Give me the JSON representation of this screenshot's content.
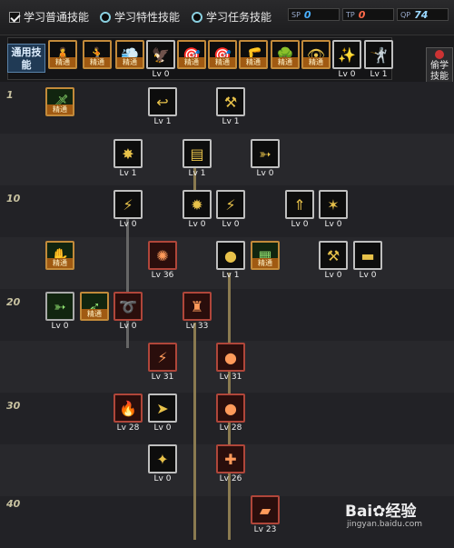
{
  "topbar": {
    "options": [
      {
        "label": "学习普通技能",
        "type": "checkbox",
        "checked": true
      },
      {
        "label": "学习特性技能",
        "type": "radio"
      },
      {
        "label": "学习任务技能",
        "type": "radio"
      }
    ],
    "sp": [
      {
        "tag": "SP",
        "value": "0",
        "color": "#4ab0ff"
      },
      {
        "tag": "TP",
        "value": "0",
        "color": "#ff6a4a"
      },
      {
        "tag": "QP",
        "value": "74",
        "color": "#9ad8ff"
      }
    ]
  },
  "common_skills": {
    "label": "通用技能",
    "items": [
      {
        "icon": "figure-icon",
        "glyph": "🧍",
        "badge": "精通"
      },
      {
        "icon": "leap-icon",
        "glyph": "🏃",
        "badge": "精通"
      },
      {
        "icon": "dash-icon",
        "glyph": "💨",
        "badge": "精通"
      },
      {
        "icon": "wing-icon",
        "glyph": "🦅",
        "level": "Lv 0"
      },
      {
        "icon": "target-icon",
        "glyph": "🎯",
        "badge": "精通"
      },
      {
        "icon": "target-icon",
        "glyph": "🎯",
        "badge": "精通"
      },
      {
        "icon": "kick-icon",
        "glyph": "🦵",
        "badge": "精通"
      },
      {
        "icon": "tree-icon",
        "glyph": "🌳",
        "badge": "精通"
      },
      {
        "icon": "eye-icon",
        "glyph": "👁",
        "badge": "精通"
      },
      {
        "icon": "power-icon",
        "glyph": "✨",
        "level": "Lv 0"
      },
      {
        "icon": "stance-icon",
        "glyph": "🤺",
        "level": "Lv 1"
      }
    ]
  },
  "side_tab": {
    "label": "偷学技能"
  },
  "levels": [
    "1",
    "10",
    "20",
    "30",
    "40"
  ],
  "tree": [
    {
      "icon": "dagger-stab-icon",
      "glyph": "🗡",
      "badge": "精通",
      "color": "green"
    },
    {
      "icon": "throw-icon",
      "glyph": "↩",
      "level": "Lv 1"
    },
    {
      "icon": "swing-icon",
      "glyph": "⚒",
      "level": "Lv 1"
    },
    {
      "icon": "burst-icon",
      "glyph": "✸",
      "level": "Lv 1"
    },
    {
      "icon": "rifle-icon",
      "glyph": "▤",
      "level": "Lv 1"
    },
    {
      "icon": "pistol-icon",
      "glyph": "➳",
      "level": "Lv 0"
    },
    {
      "icon": "slash-icon",
      "glyph": "⚡",
      "level": "Lv 0"
    },
    {
      "icon": "bomb-icon",
      "glyph": "✹",
      "level": "Lv 0"
    },
    {
      "icon": "bolt-icon",
      "glyph": "⚡",
      "level": "Lv 0"
    },
    {
      "icon": "lift-icon",
      "glyph": "⇑",
      "level": "Lv 0"
    },
    {
      "icon": "claw-icon",
      "glyph": "✶",
      "level": "Lv 0"
    },
    {
      "icon": "grab-icon",
      "glyph": "✋",
      "badge": "精通",
      "color": "green"
    },
    {
      "icon": "flame-gun-icon",
      "glyph": "✺",
      "level": "Lv 36",
      "color": "red"
    },
    {
      "icon": "grenade-icon",
      "glyph": "●",
      "level": "Lv 1"
    },
    {
      "icon": "ammo-icon",
      "glyph": "▦",
      "badge": "精通",
      "color": "green"
    },
    {
      "icon": "hammer-icon",
      "glyph": "⚒",
      "level": "Lv 0"
    },
    {
      "icon": "cannon-icon",
      "glyph": "▬",
      "level": "Lv 0"
    },
    {
      "icon": "handgun-icon",
      "glyph": "➳",
      "level": "Lv 0",
      "color": "green"
    },
    {
      "icon": "bow-icon",
      "glyph": "➶",
      "badge": "精通",
      "color": "green"
    },
    {
      "icon": "kick-icon",
      "glyph": "➰",
      "level": "Lv 0",
      "color": "red"
    },
    {
      "icon": "turret-icon",
      "glyph": "♜",
      "level": "Lv 33",
      "color": "red"
    },
    {
      "icon": "laser-icon",
      "glyph": "⚡",
      "level": "Lv 31",
      "color": "red"
    },
    {
      "icon": "grenade-red-icon",
      "glyph": "●",
      "level": "Lv 31",
      "color": "red"
    },
    {
      "icon": "fire-icon",
      "glyph": "🔥",
      "level": "Lv 28",
      "color": "red"
    },
    {
      "icon": "missile-icon",
      "glyph": "➤",
      "level": "Lv 0"
    },
    {
      "icon": "bomb-red-icon",
      "glyph": "●",
      "level": "Lv 28",
      "color": "red"
    },
    {
      "icon": "spark-icon",
      "glyph": "✦",
      "level": "Lv 0"
    },
    {
      "icon": "crossfire-icon",
      "glyph": "✚",
      "level": "Lv 26",
      "color": "red"
    },
    {
      "icon": "tank-icon",
      "glyph": "▰",
      "level": "Lv 23",
      "color": "red"
    }
  ],
  "watermark": {
    "text": "Bai✿经验",
    "sub": "jingyan.baidu.com"
  }
}
